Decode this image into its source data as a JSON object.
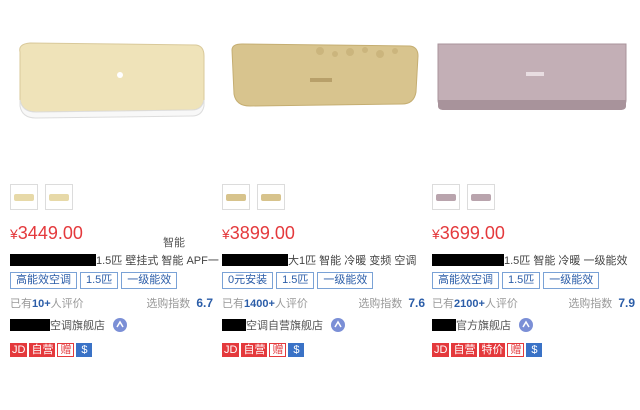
{
  "products": [
    {
      "price_symbol": "¥",
      "price": "3449.00",
      "side_tag": "智能",
      "title": "1.5匹 壁挂式 智能 APF一",
      "tags": [
        "高能效空调",
        "1.5匹",
        "一级能效"
      ],
      "review_prefix": "已有",
      "review_count": "10+",
      "review_suffix": "人评价",
      "index_label": "选购指数",
      "index_score": "6.7",
      "shop_name": "空调旗舰店",
      "badges": [
        "JD",
        "自营",
        "赠",
        "bag"
      ],
      "body_color": "#e7d9a8",
      "icons": {
        "chat": "chat-bubble-icon",
        "bag": "money-bag-icon"
      }
    },
    {
      "price_symbol": "¥",
      "price": "3899.00",
      "side_tag": "",
      "title": "大1匹 智能 冷暖 变频 空调",
      "tags": [
        "0元安装",
        "1.5匹",
        "一级能效"
      ],
      "review_prefix": "已有",
      "review_count": "1400+",
      "review_suffix": "人评价",
      "index_label": "选购指数",
      "index_score": "7.6",
      "shop_name": "空调自营旗舰店",
      "badges": [
        "JD",
        "自营",
        "赠",
        "bag"
      ],
      "body_color": "#d7c38c",
      "icons": {
        "chat": "chat-bubble-icon",
        "bag": "money-bag-icon"
      }
    },
    {
      "price_symbol": "¥",
      "price": "3699.00",
      "side_tag": "",
      "title": "1.5匹 智能 冷暖 一级能效",
      "tags": [
        "高能效空调",
        "1.5匹",
        "一级能效"
      ],
      "review_prefix": "已有",
      "review_count": "2100+",
      "review_suffix": "人评价",
      "index_label": "选购指数",
      "index_score": "7.9",
      "shop_name": "官方旗舰店",
      "badges": [
        "JD",
        "自营",
        "特价",
        "赠",
        "bag"
      ],
      "body_color": "#b9a4ad",
      "icons": {
        "chat": "chat-bubble-icon",
        "bag": "money-bag-icon"
      }
    }
  ]
}
